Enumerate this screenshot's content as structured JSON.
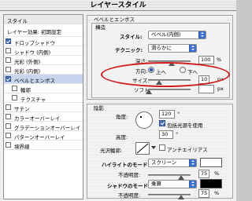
{
  "window": {
    "title": "レイヤースタイル"
  },
  "left_panel": {
    "header": "スタイル",
    "blend_options": "レイヤー効果: 初期設定",
    "items": [
      {
        "label": "ドロップシャドウ",
        "checked": true
      },
      {
        "label": "シャドウ (内側)",
        "checked": false
      },
      {
        "label": "光彩 (外側)",
        "checked": false
      },
      {
        "label": "光彩 (内側)",
        "checked": false
      },
      {
        "label": "ベベルとエンボス",
        "checked": true,
        "selected": true
      },
      {
        "label": "輪郭",
        "checked": false,
        "sub": true
      },
      {
        "label": "テクスチャ",
        "checked": false,
        "sub": true
      },
      {
        "label": "サテン",
        "checked": false
      },
      {
        "label": "カラーオーバーレイ",
        "checked": false
      },
      {
        "label": "グラデーションオーバーレイ",
        "checked": false
      },
      {
        "label": "パターンオーバーレイ",
        "checked": false
      },
      {
        "label": "境界線",
        "checked": false
      }
    ]
  },
  "bevel": {
    "group_title": "ベベルとエンボス",
    "structure_title": "構造",
    "style_label": "スタイル:",
    "style_value": "ベベル(内側)",
    "technique_label": "テクニック:",
    "technique_value": "滑らかに",
    "depth_label": "深さ:",
    "depth_value": "100",
    "depth_unit": "%",
    "direction_label": "方向:",
    "direction_up": "上へ",
    "direction_down": "下へ",
    "direction_selected": "up",
    "size_label": "サイズ:",
    "size_value": "10",
    "size_unit": "px",
    "soften_label": "ソフト:",
    "soften_unit": "px"
  },
  "shading": {
    "title": "陰影",
    "angle_label": "角度:",
    "angle_value": "120",
    "angle_unit": "°",
    "global_light_label": "包括光源を使用",
    "global_light_checked": true,
    "altitude_label": "高度:",
    "altitude_value": "30",
    "altitude_unit": "°",
    "gloss_label": "光沢輪郭:",
    "antialias_label": "アンチエイリアス",
    "antialias_checked": false,
    "highlight_label": "ハイライトのモード:",
    "highlight_value": "スクリーン",
    "highlight_opacity_label": "不透明度:",
    "highlight_opacity_value": "75",
    "highlight_opacity_unit": "%",
    "shadow_label": "シャドウのモード:",
    "shadow_value": "乗算",
    "shadow_opacity_label": "不透明度:",
    "shadow_opacity_value": "75",
    "shadow_opacity_unit": "%"
  },
  "colors": {
    "highlight_swatch": "#ffffff",
    "shadow_swatch": "#000000",
    "annotation": "#d01c1c",
    "accent": "#3b6fd0"
  }
}
